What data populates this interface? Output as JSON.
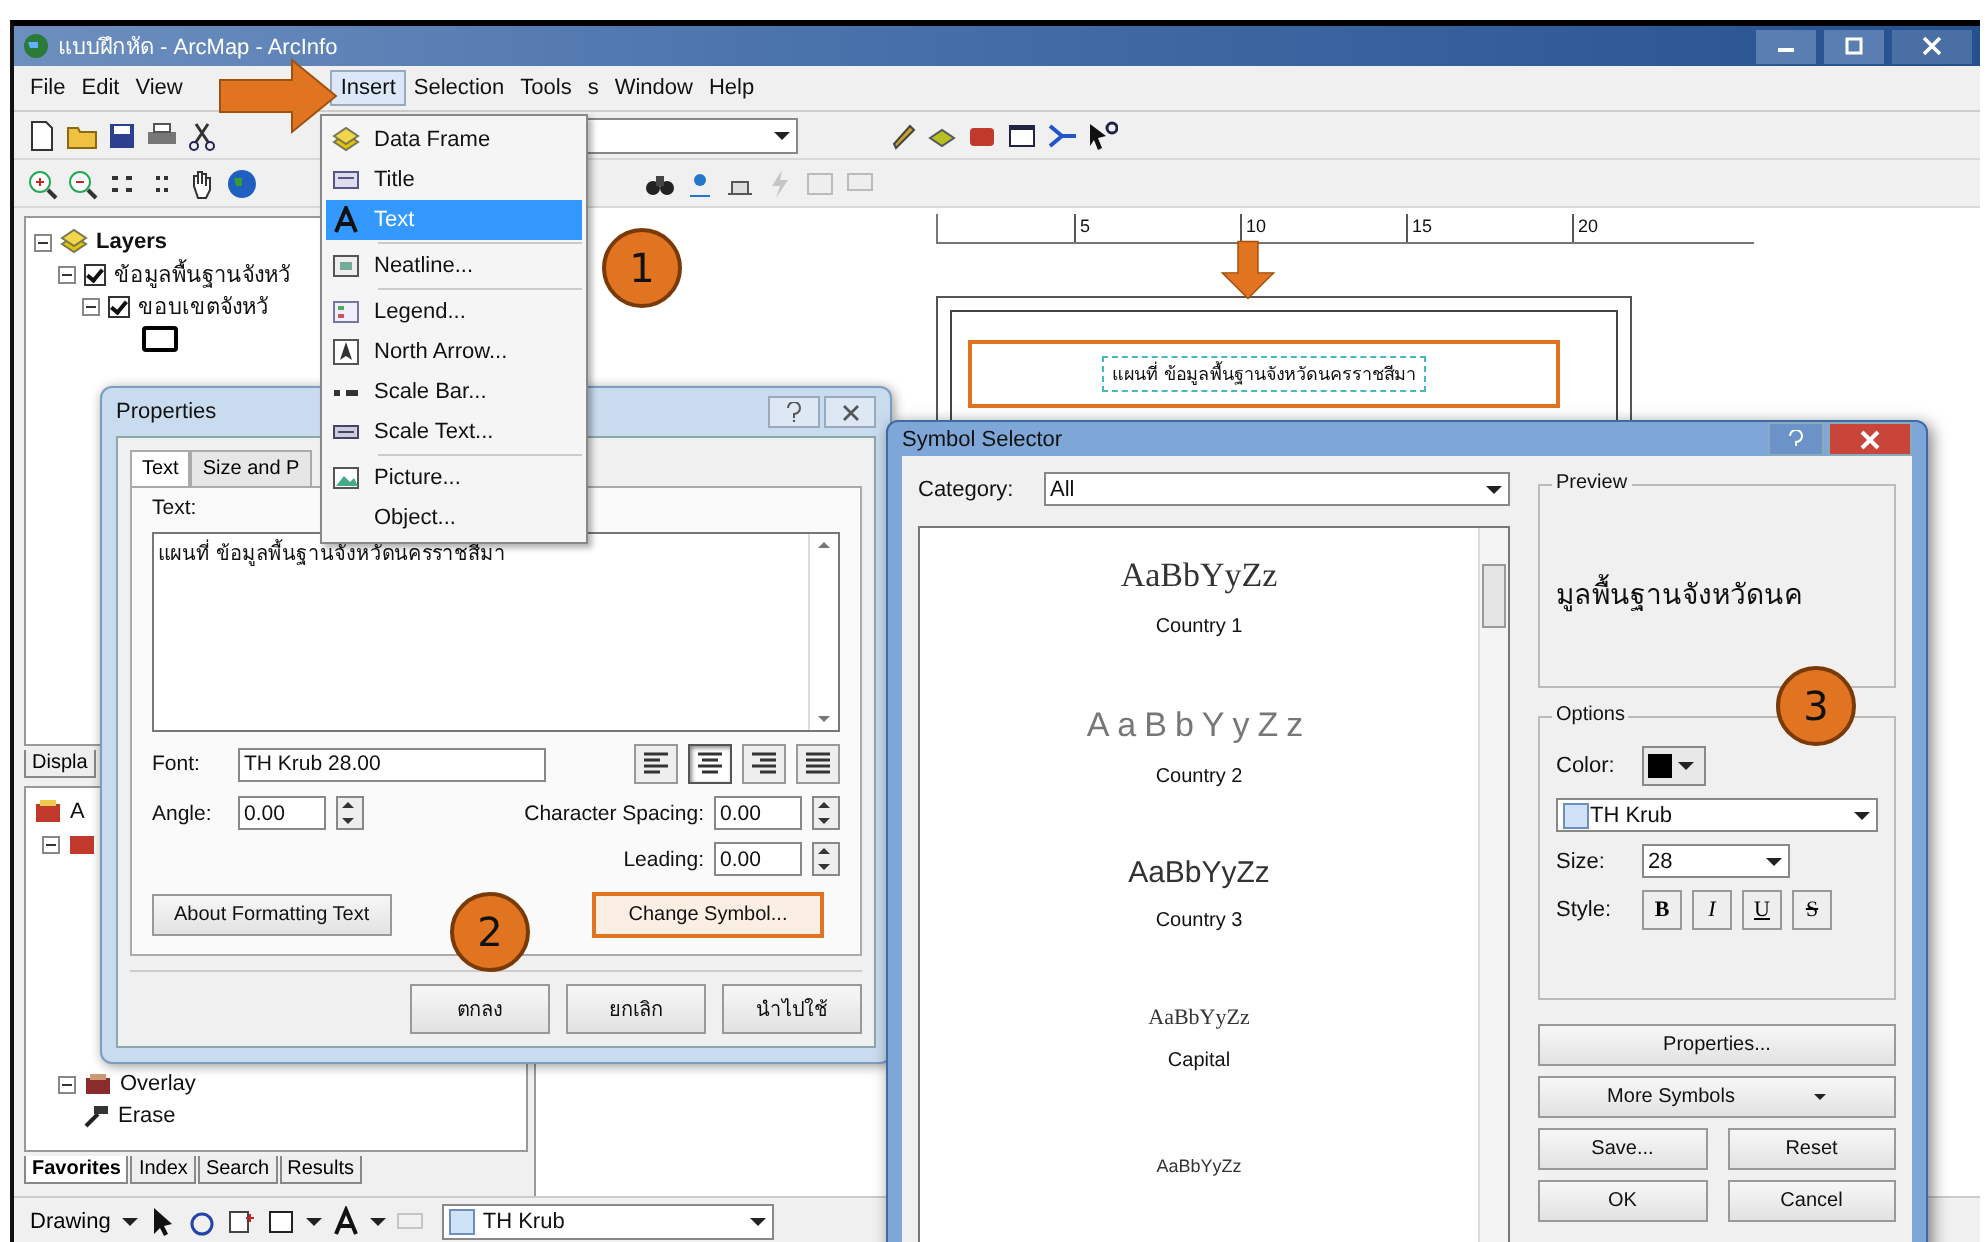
{
  "window": {
    "title": "แบบฝึกหัด - ArcMap - ArcInfo"
  },
  "menu_bar": [
    {
      "label": "File",
      "selected": false
    },
    {
      "label": "Edit",
      "selected": false
    },
    {
      "label": "View",
      "selected": false
    },
    {
      "label": "Insert",
      "selected": true
    },
    {
      "label": "Selection",
      "selected": false
    },
    {
      "label": "Tools",
      "selected": false
    },
    {
      "label": "s",
      "selected": false
    },
    {
      "label": "Window",
      "selected": false
    },
    {
      "label": "Help",
      "selected": false
    }
  ],
  "insert_menu": {
    "groups": [
      [
        {
          "label": "Data Frame",
          "kind": "data-frame",
          "selected": false
        },
        {
          "label": "Title",
          "kind": "title",
          "selected": false
        },
        {
          "label": "Text",
          "kind": "text",
          "selected": true
        }
      ],
      [
        {
          "label": "Neatline...",
          "kind": "neatline",
          "selected": false
        }
      ],
      [
        {
          "label": "Legend...",
          "kind": "legend",
          "selected": false
        },
        {
          "label": "North Arrow...",
          "kind": "north-arrow",
          "selected": false
        },
        {
          "label": "Scale Bar...",
          "kind": "scale-bar",
          "selected": false
        },
        {
          "label": "Scale Text...",
          "kind": "scale-text",
          "selected": false
        }
      ],
      [
        {
          "label": "Picture...",
          "kind": "picture",
          "selected": false
        },
        {
          "label": "Object...",
          "kind": "none",
          "selected": false
        }
      ]
    ]
  },
  "table_of_contents": {
    "layers": [
      {
        "label": "Layers",
        "expanded": true,
        "children": [
          {
            "label": "ข้อมูลพื้นฐานจังหวั",
            "checked": true,
            "expanded": true,
            "children": [
              {
                "label": "ขอบเขตจังหวั",
                "checked": true,
                "expanded": true
              }
            ]
          }
        ]
      }
    ],
    "tab": "Displa"
  },
  "toolbox": {
    "tree": [
      {
        "label": "A",
        "expanded": true,
        "children": [
          {
            "label": "Overlay",
            "expanded": true,
            "children": [
              {
                "label": "Erase"
              }
            ]
          }
        ]
      }
    ],
    "tabs": [
      {
        "label": "Favorites",
        "selected": true
      },
      {
        "label": "Index",
        "selected": false
      },
      {
        "label": "Search",
        "selected": false
      },
      {
        "label": "Results",
        "selected": false
      }
    ]
  },
  "ruler": {
    "ticks": [
      "5",
      "10",
      "15",
      "20"
    ]
  },
  "layout_page": {
    "map_title": "แผนที่ ข้อมูลพื้นฐานจังหวัดนครราชสีมา",
    "highlighted": true
  },
  "properties_dialog": {
    "title": "Properties",
    "tabs": [
      {
        "label": "Text",
        "selected": true
      },
      {
        "label": "Size and P",
        "selected": false
      }
    ],
    "text_label": "Text:",
    "text_value": "แผนที่ ข้อมูลพื้นฐานจังหวัดนครราชสีมา",
    "font_label": "Font:",
    "font_value": "TH Krub 28.00",
    "alignment": [
      {
        "kind": "left",
        "selected": false
      },
      {
        "kind": "center",
        "selected": true
      },
      {
        "kind": "right",
        "selected": false
      },
      {
        "kind": "justify",
        "selected": false
      }
    ],
    "angle_label": "Angle:",
    "angle_value": "0.00",
    "spacing_label": "Character Spacing:",
    "spacing_value": "0.00",
    "leading_label": "Leading:",
    "leading_value": "0.00",
    "buttons": [
      {
        "label": "About Formatting Text",
        "highlighted": false
      },
      {
        "label": "Change Symbol...",
        "highlighted": true
      }
    ],
    "footer_buttons": [
      "ตกลง",
      "ยกเลิก",
      "นำไปใช้"
    ]
  },
  "symbol_selector": {
    "title": "Symbol Selector",
    "category_label": "Category:",
    "category_value": "All",
    "symbols": [
      {
        "sample": "AaBbYyZz",
        "name": "Country 1",
        "kind": "serif"
      },
      {
        "sample": "AaBbYyZz",
        "name": "Country 2",
        "kind": "spaced"
      },
      {
        "sample": "AaBbYyZz",
        "name": "Country 3",
        "kind": "sans"
      },
      {
        "sample": "AaBbYyZz",
        "name": "Capital",
        "kind": "small-serif"
      },
      {
        "sample": "AaBbYyZz",
        "kind": "tiny"
      }
    ],
    "preview_label": "Preview",
    "preview_text": "มูลพื้นฐานจังหวัดนค",
    "options_label": "Options",
    "color_label": "Color:",
    "color": "#000000",
    "font_value": "TH Krub",
    "size_label": "Size:",
    "size_value": "28",
    "style_label": "Style:",
    "styles": [
      {
        "label": "B",
        "kind": "bold"
      },
      {
        "label": "I",
        "kind": "italic"
      },
      {
        "label": "U",
        "kind": "underline"
      },
      {
        "label": "S",
        "kind": "strike"
      }
    ],
    "buttons": [
      {
        "label": "Properties...",
        "kind": "wide"
      },
      {
        "label": "More Symbols",
        "kind": "dropdown"
      },
      {
        "label": "Save...",
        "kind": "half"
      },
      {
        "label": "Reset",
        "kind": "half"
      },
      {
        "label": "OK",
        "kind": "half"
      },
      {
        "label": "Cancel",
        "kind": "half"
      }
    ]
  },
  "drawing_toolbar": {
    "label": "Drawing",
    "font_value": "TH Krub"
  },
  "steps": [
    "1",
    "2",
    "3"
  ]
}
